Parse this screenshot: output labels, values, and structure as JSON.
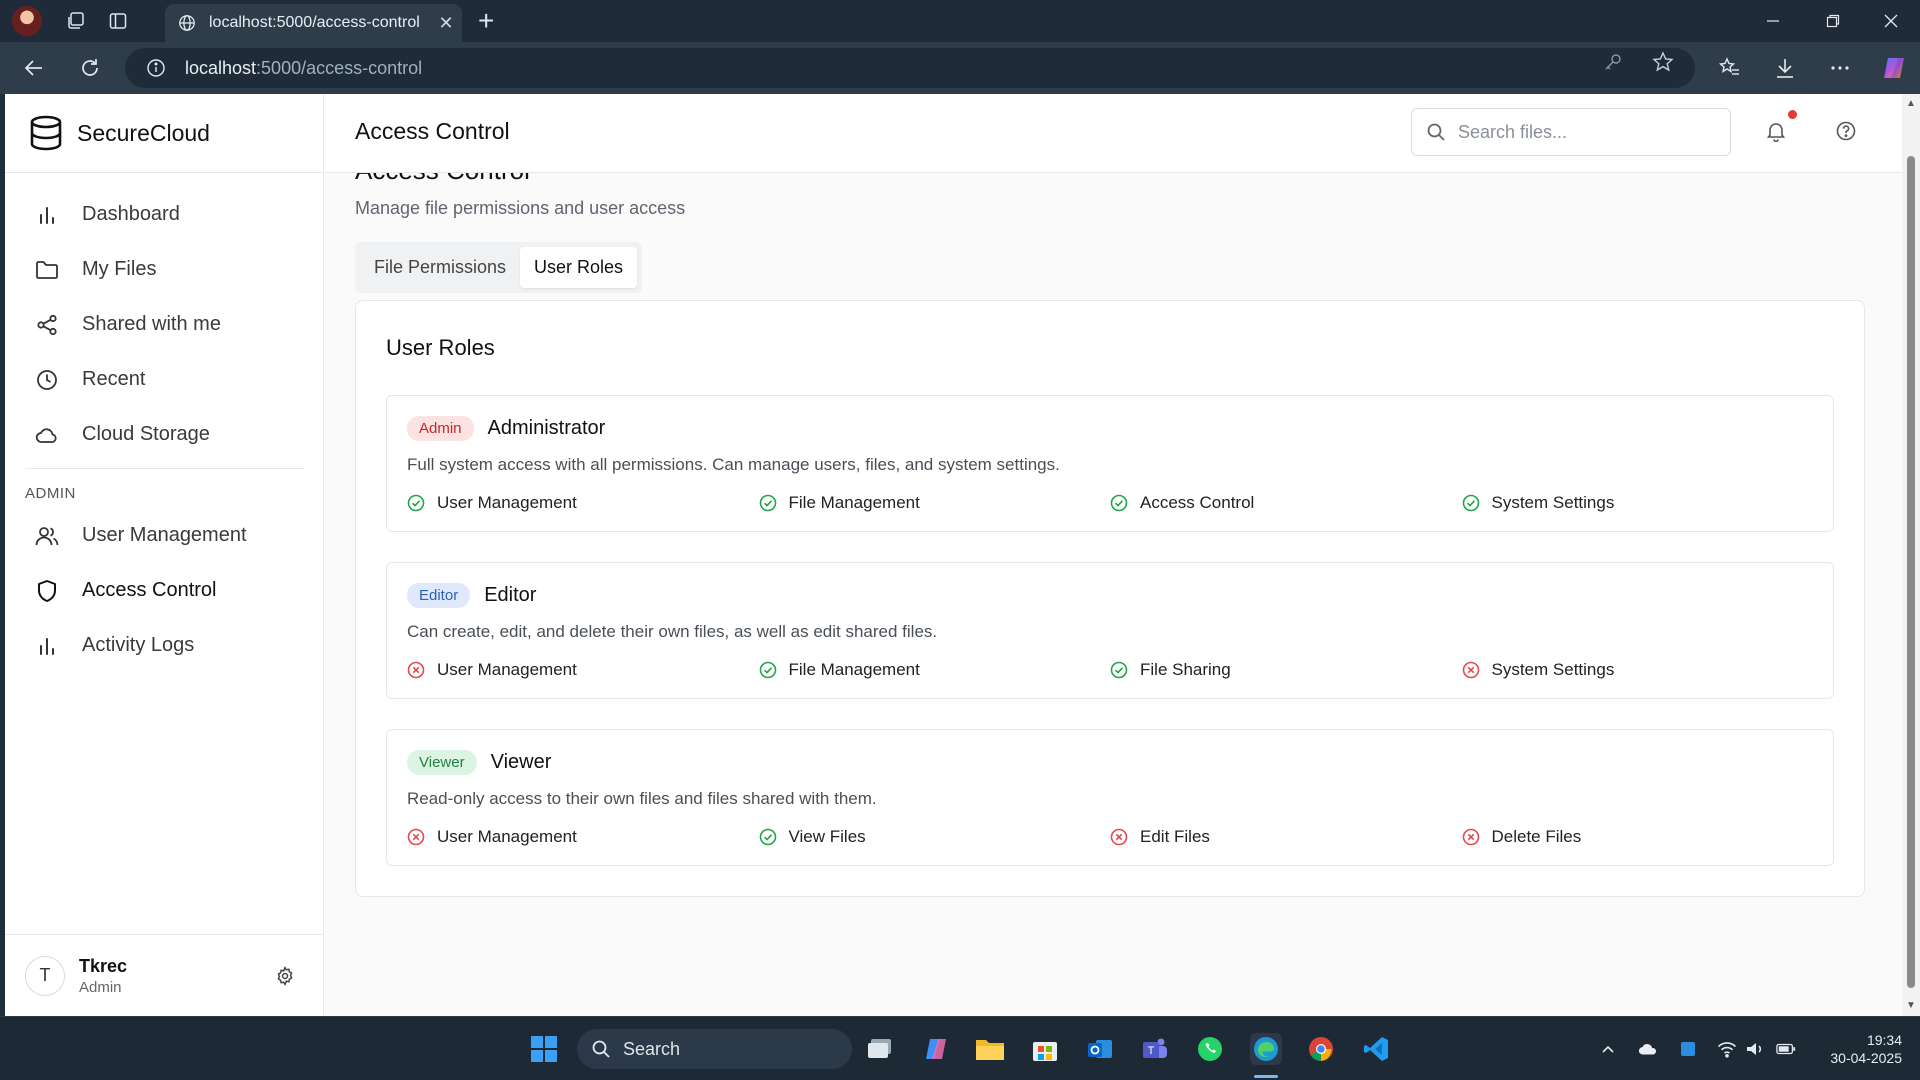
{
  "browser": {
    "tab_title": "localhost:5000/access-control",
    "url_host": "localhost",
    "url_path": ":5000/access-control"
  },
  "app": {
    "brand": "SecureCloud",
    "header_title": "Access Control",
    "search_placeholder": "Search files..."
  },
  "sidebar": {
    "items": [
      {
        "label": "Dashboard",
        "icon": "bar-chart-icon"
      },
      {
        "label": "My Files",
        "icon": "folder-icon"
      },
      {
        "label": "Shared with me",
        "icon": "share-icon"
      },
      {
        "label": "Recent",
        "icon": "clock-icon"
      },
      {
        "label": "Cloud Storage",
        "icon": "cloud-icon"
      }
    ],
    "admin_label": "ADMIN",
    "admin_items": [
      {
        "label": "User Management",
        "icon": "users-icon"
      },
      {
        "label": "Access Control",
        "icon": "shield-icon",
        "active": true
      },
      {
        "label": "Activity Logs",
        "icon": "bar-chart-icon"
      }
    ],
    "user": {
      "initial": "T",
      "name": "Tkrec",
      "role": "Admin"
    }
  },
  "main": {
    "title": "Access Control",
    "subtitle": "Manage file permissions and user access",
    "tabs": [
      {
        "label": "File Permissions",
        "active": false
      },
      {
        "label": "User Roles",
        "active": true
      }
    ],
    "card_title": "User Roles",
    "roles": [
      {
        "badge": "Admin",
        "name": "Administrator",
        "description": "Full system access with all permissions. Can manage users, files, and system settings.",
        "permissions": [
          {
            "label": "User Management",
            "allowed": true
          },
          {
            "label": "File Management",
            "allowed": true
          },
          {
            "label": "Access Control",
            "allowed": true
          },
          {
            "label": "System Settings",
            "allowed": true
          }
        ]
      },
      {
        "badge": "Editor",
        "name": "Editor",
        "description": "Can create, edit, and delete their own files, as well as edit shared files.",
        "permissions": [
          {
            "label": "User Management",
            "allowed": false
          },
          {
            "label": "File Management",
            "allowed": true
          },
          {
            "label": "File Sharing",
            "allowed": true
          },
          {
            "label": "System Settings",
            "allowed": false
          }
        ]
      },
      {
        "badge": "Viewer",
        "name": "Viewer",
        "description": "Read-only access to their own files and files shared with them.",
        "permissions": [
          {
            "label": "User Management",
            "allowed": false
          },
          {
            "label": "View Files",
            "allowed": true
          },
          {
            "label": "Edit Files",
            "allowed": false
          },
          {
            "label": "Delete Files",
            "allowed": false
          }
        ]
      }
    ]
  },
  "taskbar": {
    "search_label": "Search",
    "time": "19:34",
    "date": "30-04-2025"
  },
  "colors": {
    "allowed": "#22a447",
    "denied": "#e5484d",
    "badge_admin_bg": "#fde2e2",
    "badge_admin_fg": "#c62828",
    "badge_editor_bg": "#dfe9fb",
    "badge_editor_fg": "#2f5fb8",
    "badge_viewer_bg": "#dcf5e3",
    "badge_viewer_fg": "#23803f"
  }
}
